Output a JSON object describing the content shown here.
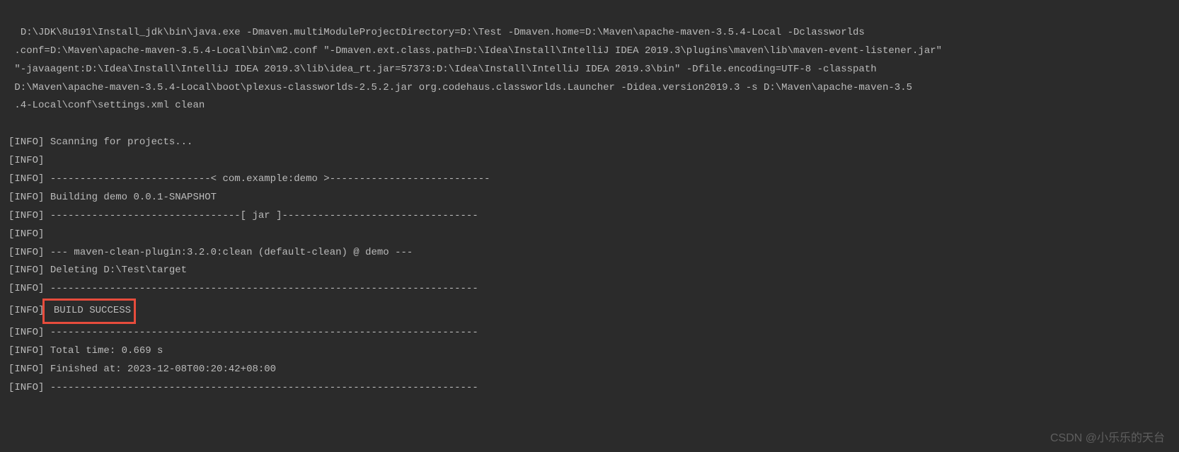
{
  "console": {
    "command": "D:\\JDK\\8u191\\Install_jdk\\bin\\java.exe -Dmaven.multiModuleProjectDirectory=D:\\Test -Dmaven.home=D:\\Maven\\apache-maven-3.5.4-Local -Dclassworlds\n .conf=D:\\Maven\\apache-maven-3.5.4-Local\\bin\\m2.conf \"-Dmaven.ext.class.path=D:\\Idea\\Install\\IntelliJ IDEA 2019.3\\plugins\\maven\\lib\\maven-event-listener.jar\"\n \"-javaagent:D:\\Idea\\Install\\IntelliJ IDEA 2019.3\\lib\\idea_rt.jar=57373:D:\\Idea\\Install\\IntelliJ IDEA 2019.3\\bin\" -Dfile.encoding=UTF-8 -classpath\n D:\\Maven\\apache-maven-3.5.4-Local\\boot\\plexus-classworlds-2.5.2.jar org.codehaus.classworlds.Launcher -Didea.version2019.3 -s D:\\Maven\\apache-maven-3.5\n .4-Local\\conf\\settings.xml clean",
    "lines": [
      {
        "prefix": "[INFO]",
        "text": " Scanning for projects..."
      },
      {
        "prefix": "[INFO]",
        "text": ""
      },
      {
        "prefix": "[INFO]",
        "text": " ---------------------------< com.example:demo >---------------------------"
      },
      {
        "prefix": "[INFO]",
        "text": " Building demo 0.0.1-SNAPSHOT"
      },
      {
        "prefix": "[INFO]",
        "text": " --------------------------------[ jar ]---------------------------------"
      },
      {
        "prefix": "[INFO]",
        "text": " "
      },
      {
        "prefix": "[INFO]",
        "text": " --- maven-clean-plugin:3.2.0:clean (default-clean) @ demo ---"
      },
      {
        "prefix": "[INFO]",
        "text": " Deleting D:\\Test\\target"
      },
      {
        "prefix": "[INFO]",
        "text": " ------------------------------------------------------------------------"
      },
      {
        "prefix": "[INFO]",
        "text": " BUILD SUCCESS",
        "highlight": true
      },
      {
        "prefix": "[INFO]",
        "text": " ------------------------------------------------------------------------"
      },
      {
        "prefix": "[INFO]",
        "text": " Total time: 0.669 s"
      },
      {
        "prefix": "[INFO]",
        "text": " Finished at: 2023-12-08T00:20:42+08:00"
      },
      {
        "prefix": "[INFO]",
        "text": " ------------------------------------------------------------------------"
      }
    ]
  },
  "watermark": "CSDN @小乐乐的天台"
}
